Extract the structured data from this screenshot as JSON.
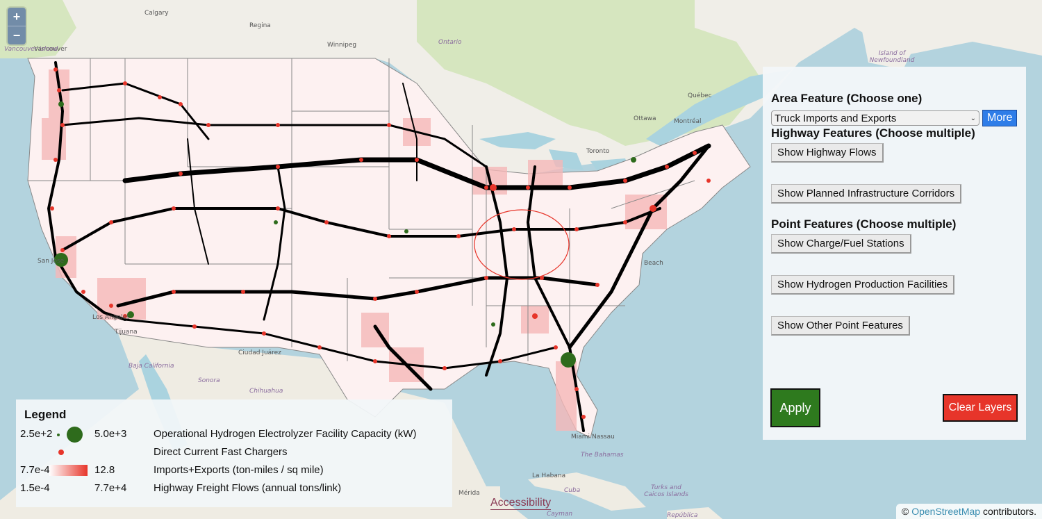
{
  "map": {
    "zoom_in_label": "+",
    "zoom_out_label": "−",
    "labels": [
      {
        "text": "Calgary",
        "kind": "city"
      },
      {
        "text": "Regina",
        "kind": "city"
      },
      {
        "text": "Winnipeg",
        "kind": "city"
      },
      {
        "text": "Vancouver",
        "kind": "city"
      },
      {
        "text": "Vancouver Island",
        "kind": "region"
      },
      {
        "text": "Ontario",
        "kind": "region"
      },
      {
        "text": "Québec",
        "kind": "city"
      },
      {
        "text": "Ottawa",
        "kind": "city"
      },
      {
        "text": "Montréal",
        "kind": "city"
      },
      {
        "text": "Toronto",
        "kind": "city"
      },
      {
        "text": "Island of Newfoundland",
        "kind": "region"
      },
      {
        "text": "San Jose",
        "kind": "city"
      },
      {
        "text": "Los Angeles",
        "kind": "city"
      },
      {
        "text": "Tijuana",
        "kind": "city"
      },
      {
        "text": "Baja California",
        "kind": "region"
      },
      {
        "text": "Sonora",
        "kind": "region"
      },
      {
        "text": "Chihuahua",
        "kind": "region"
      },
      {
        "text": "Ciudad Juárez",
        "kind": "city"
      },
      {
        "text": "Beach",
        "kind": "city"
      },
      {
        "text": "Miami",
        "kind": "city"
      },
      {
        "text": "Nassau",
        "kind": "city"
      },
      {
        "text": "The Bahamas",
        "kind": "region"
      },
      {
        "text": "La Habana",
        "kind": "city"
      },
      {
        "text": "Cuba",
        "kind": "region"
      },
      {
        "text": "Cayman",
        "kind": "region"
      },
      {
        "text": "Mérida",
        "kind": "city"
      },
      {
        "text": "Turks and Caicos Islands",
        "kind": "region"
      },
      {
        "text": "República",
        "kind": "region"
      }
    ]
  },
  "panel": {
    "area_heading": "Area Feature (Choose one)",
    "area_select_value": "Truck Imports and Exports",
    "more_label": "More",
    "highway_heading": "Highway Features (Choose multiple)",
    "highway_buttons": [
      "Show Highway Flows",
      "Show Planned Infrastructure Corridors"
    ],
    "point_heading": "Point Features (Choose multiple)",
    "point_buttons": [
      "Show Charge/Fuel Stations",
      "Show Hydrogen Production Facilities",
      "Show Other Point Features"
    ],
    "apply_label": "Apply",
    "clear_label": "Clear Layers"
  },
  "legend": {
    "title": "Legend",
    "rows": [
      {
        "min": "2.5e+2",
        "max": "5.0e+3",
        "desc": "Operational Hydrogen Electrolyzer Facility Capacity (kW)"
      },
      {
        "min": "",
        "max": "",
        "desc": "Direct Current Fast Chargers"
      },
      {
        "min": "7.7e-4",
        "max": "12.8",
        "desc": "Imports+Exports (ton-miles / sq mile)"
      },
      {
        "min": "1.5e-4",
        "max": "7.7e+4",
        "desc": "Highway Freight Flows (annual tons/link)"
      }
    ]
  },
  "colors": {
    "charger": "#e7352a",
    "electrolyzer": "#2e6b1c",
    "area_high": "#e7352a",
    "apply": "#2e7a1e",
    "clear": "#e7352a",
    "more": "#2f7de8"
  },
  "attribution": {
    "symbol": "©",
    "link": "OpenStreetMap",
    "suffix": "contributors."
  },
  "accessibility_label": "Accessibility"
}
